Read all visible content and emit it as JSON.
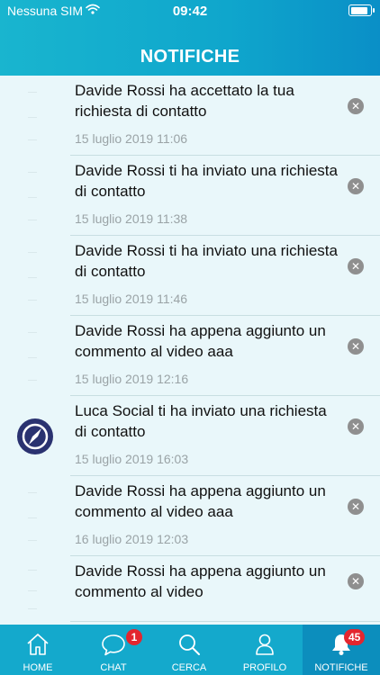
{
  "status_bar": {
    "carrier": "Nessuna SIM",
    "time": "09:42",
    "battery_level": 0.9
  },
  "header": {
    "title": "NOTIFICHE"
  },
  "notifications": [
    {
      "message": "Davide Rossi ha accettato la tua richiesta di contatto",
      "date": "15 luglio 2019 11:06",
      "has_avatar": false
    },
    {
      "message": "Davide Rossi ti ha inviato una richiesta di contatto",
      "date": "15 luglio 2019 11:38",
      "has_avatar": false
    },
    {
      "message": "Davide Rossi ti ha inviato una richiesta di contatto",
      "date": "15 luglio 2019 11:46",
      "has_avatar": false
    },
    {
      "message": "Davide Rossi ha appena aggiunto un commento al video aaa",
      "date": "15 luglio 2019 12:16",
      "has_avatar": false
    },
    {
      "message": "Luca Social ti ha inviato una richiesta di contatto",
      "date": "15 luglio 2019 16:03",
      "has_avatar": true
    },
    {
      "message": "Davide Rossi ha appena aggiunto un commento al video aaa",
      "date": "16 luglio 2019 12:03",
      "has_avatar": false
    },
    {
      "message": "Davide Rossi ha appena aggiunto un commento al video",
      "date": "",
      "has_avatar": false
    }
  ],
  "tabbar": {
    "tabs": [
      {
        "label": "HOME",
        "icon": "home-icon",
        "badge": ""
      },
      {
        "label": "CHAT",
        "icon": "chat-icon",
        "badge": "1"
      },
      {
        "label": "CERCA",
        "icon": "search-icon",
        "badge": ""
      },
      {
        "label": "PROFILO",
        "icon": "profile-icon",
        "badge": ""
      },
      {
        "label": "NOTIFICHE",
        "icon": "bell-icon",
        "badge": "45"
      }
    ],
    "active": "NOTIFICHE"
  },
  "colors": {
    "header": "#14a9cc",
    "background": "#e9f7fa",
    "badge": "#e3262f",
    "avatar": "#2a3270"
  }
}
